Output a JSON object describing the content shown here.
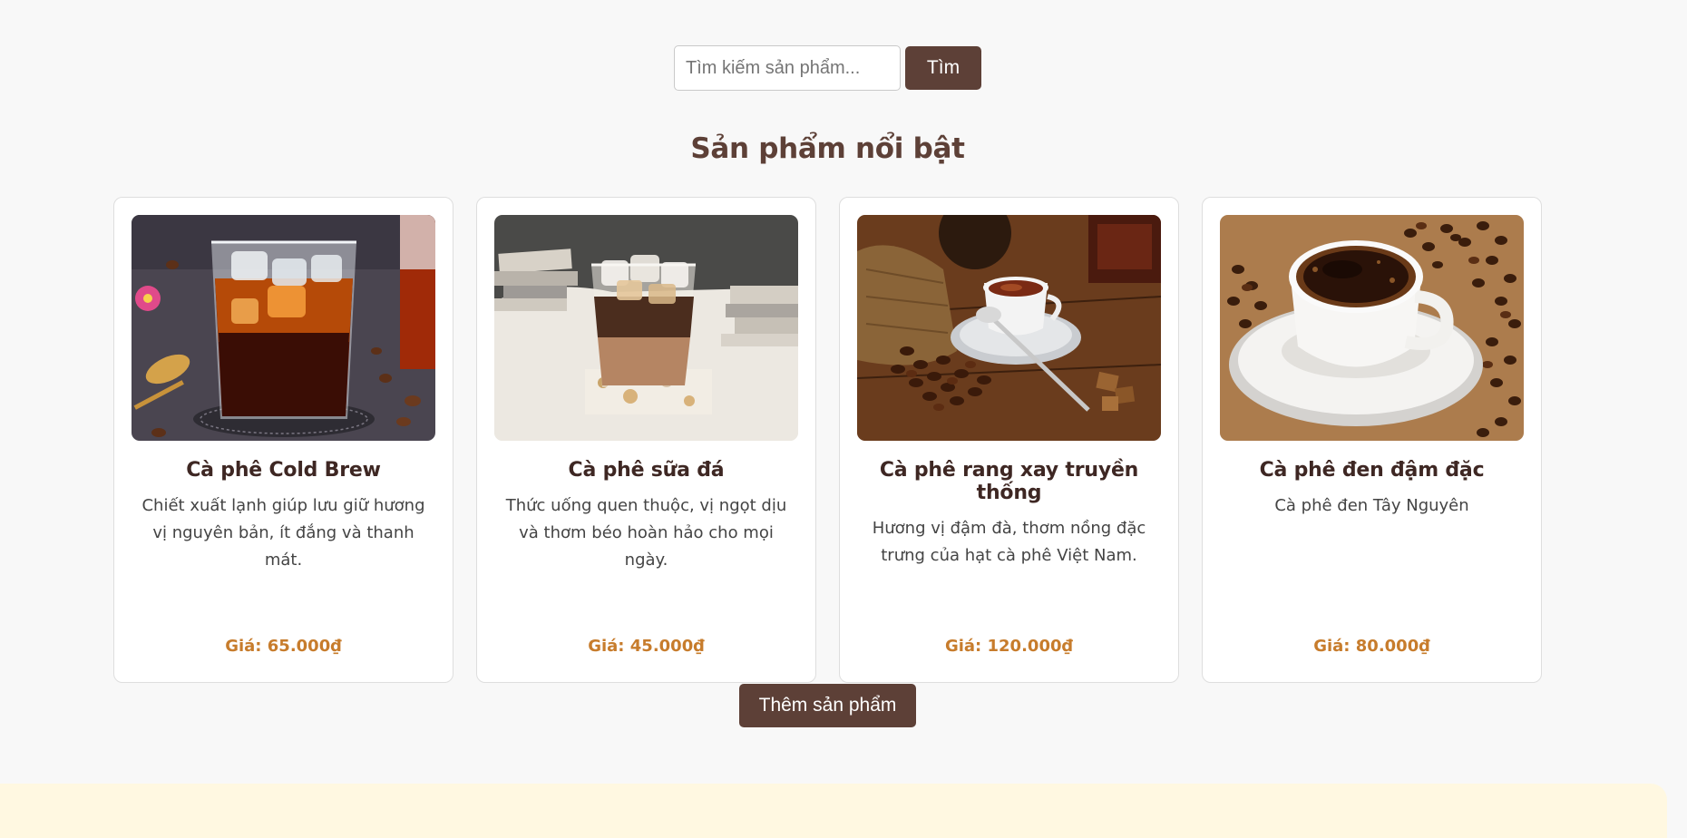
{
  "search": {
    "placeholder": "Tìm kiếm sản phẩm...",
    "value": "",
    "button_label": "Tìm"
  },
  "section": {
    "title": "Sản phẩm nổi bật"
  },
  "products": [
    {
      "name": "Cà phê Cold Brew",
      "description": "Chiết xuất lạnh giúp lưu giữ hương vị nguyên bản, ít đắng và thanh mát.",
      "price": "Giá: 65.000₫",
      "image_subject": "iced-cold-brew-glass"
    },
    {
      "name": "Cà phê sữa đá",
      "description": "Thức uống quen thuộc, vị ngọt dịu và thơm béo hoàn hảo cho mọi ngày.",
      "price": "Giá: 45.000₫",
      "image_subject": "iced-milk-coffee-glass"
    },
    {
      "name": "Cà phê rang xay truyền thống",
      "description": "Hương vị đậm đà, thơm nồng đặc trưng của hạt cà phê Việt Nam.",
      "price": "Giá: 120.000₫",
      "image_subject": "coffee-cup-with-beans-and-sack"
    },
    {
      "name": "Cà phê đen đậm đặc",
      "description": "Cà phê đen Tây Nguyên",
      "price": "Giá: 80.000₫",
      "image_subject": "black-coffee-cup-on-beans"
    }
  ],
  "actions": {
    "add_product_label": "Thêm sản phẩm"
  },
  "colors": {
    "brand_brown": "#5d4037",
    "price_accent": "#c77c2c",
    "footer_background": "#fff8e1",
    "page_background": "#f8f8f8"
  }
}
